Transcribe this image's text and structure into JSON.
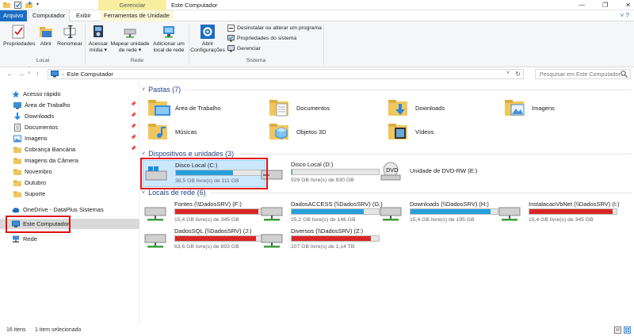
{
  "titlebar": {
    "context_tab": "Gerenciar",
    "title": "Este Computador"
  },
  "ribbon_tabs": {
    "file": "Arquivo",
    "computer": "Computador",
    "view": "Exibir",
    "drive_tools": "Ferramentas de Unidade"
  },
  "ribbon": {
    "location": {
      "properties": "Propriedades",
      "open": "Abrir",
      "rename": "Renomear",
      "label": "Local"
    },
    "network": {
      "access_media_1": "Acessar",
      "access_media_2": "mídia",
      "map_drive_1": "Mapear unidade",
      "map_drive_2": "de rede",
      "add_location_1": "Adicionar um",
      "add_location_2": "local de rede",
      "label": "Rede"
    },
    "system": {
      "open_settings_1": "Abrir",
      "open_settings_2": "Configurações",
      "uninstall": "Desinstalar ou alterar um programa",
      "system_properties": "Propriedades do sistema",
      "manage": "Gerenciar",
      "label": "Sistema"
    }
  },
  "address": {
    "path": "Este Computador",
    "search_placeholder": "Pesquisar em Este Computador"
  },
  "sidebar": {
    "quick_access": "Acesso rápido",
    "items": [
      {
        "label": "Área de Trabalho",
        "pinned": true
      },
      {
        "label": "Downloads",
        "pinned": true
      },
      {
        "label": "Documentos",
        "pinned": true
      },
      {
        "label": "Imagens",
        "pinned": true
      },
      {
        "label": "Cobrança Bancária",
        "pinned": true
      },
      {
        "label": "Imagens da Câmera",
        "pinned": false
      },
      {
        "label": "Novembro",
        "pinned": false
      },
      {
        "label": "Outubro",
        "pinned": false
      },
      {
        "label": "Suporte",
        "pinned": false
      }
    ],
    "onedrive": "OneDrive - DataPlus Sistemas",
    "this_pc": "Este Computador",
    "network": "Rede"
  },
  "content": {
    "folders_header": "Pastas (7)",
    "folders": [
      "Área de Trabalho",
      "Documentos",
      "Downloads",
      "Imagens",
      "Músicas",
      "Objetos 3D",
      "Vídeos"
    ],
    "devices_header": "Dispositivos e unidades (3)",
    "devices": [
      {
        "name": "Disco Local (C:)",
        "free": "38,5 GB livre(s) de 111 GB",
        "used_fraction": 0.65,
        "color": "#26a0da"
      },
      {
        "name": "Disco Local (D:)",
        "free": "929 GB livre(s) de 930 GB",
        "used_fraction": 0.01,
        "color": "#26a0da"
      },
      {
        "name": "Unidade de DVD-RW (E:)"
      }
    ],
    "network_header": "Locais de rede (6)",
    "network_locations": [
      {
        "name": "Fontes (\\\\DadosSRV) (F:)",
        "free": "15,4 GB livre(s) de 345 GB",
        "used_fraction": 0.955,
        "color": "#da2626"
      },
      {
        "name": "DadosACCESS (\\\\DadosSRV) (G:)",
        "free": "25,2 GB livre(s) de 146 GB",
        "used_fraction": 0.83,
        "color": "#26a0da"
      },
      {
        "name": "Downloads (\\\\DadosSRV) (H:)",
        "free": "15,4 GB livre(s) de 195 GB",
        "used_fraction": 0.92,
        "color": "#26a0da"
      },
      {
        "name": "InstalacaoVbNet (\\\\DadosSRV) (I:)",
        "free": "15,4 GB livre(s) de 345 GB",
        "used_fraction": 0.955,
        "color": "#da2626"
      },
      {
        "name": "DadosSQL (\\\\DadosSRV) (J:)",
        "free": "63,6 GB livre(s) de 893 GB",
        "used_fraction": 0.93,
        "color": "#da2626"
      },
      {
        "name": "Diversos (\\\\DadosSRV) (Z:)",
        "free": "107 GB livre(s) de 1,14 TB",
        "used_fraction": 0.91,
        "color": "#da2626"
      }
    ]
  },
  "statusbar": {
    "items": "16 itens",
    "selected": "1 item selecionado"
  },
  "colors": {
    "accent": "#1a6dc2",
    "usage_normal": "#26a0da",
    "usage_full": "#da2626",
    "highlight_box": "#e01010"
  }
}
